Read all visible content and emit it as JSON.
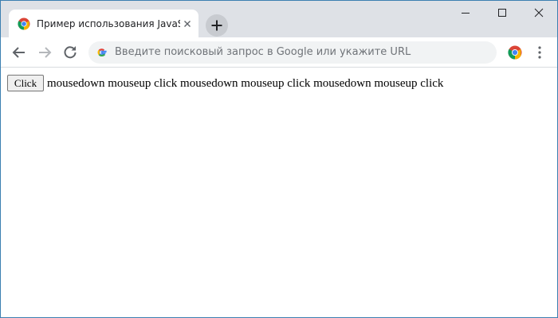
{
  "browser": {
    "tab": {
      "title": "Пример использования JavaScript",
      "favicon_icon": "chrome-logo-icon",
      "close_icon": "close-icon"
    },
    "new_tab_icon": "plus-icon",
    "window_controls": {
      "minimize_icon": "minimize-icon",
      "maximize_icon": "maximize-icon",
      "close_icon": "window-close-icon"
    },
    "nav": {
      "back_icon": "arrow-left-icon",
      "forward_icon": "arrow-right-icon",
      "reload_icon": "reload-icon"
    },
    "omnibox": {
      "icon": "google-g-icon",
      "placeholder": "Введите поисковый запрос в Google или укажите URL"
    },
    "extension_icon": "chrome-logo-icon",
    "menu_icon": "more-vertical-icon"
  },
  "page": {
    "button_label": "Click",
    "event_log": "mousedown mouseup click mousedown mouseup click mousedown mouseup click"
  },
  "colors": {
    "tabstrip": "#dee1e6",
    "window_border": "#3c7fb1",
    "omnibox": "#f1f3f4"
  }
}
